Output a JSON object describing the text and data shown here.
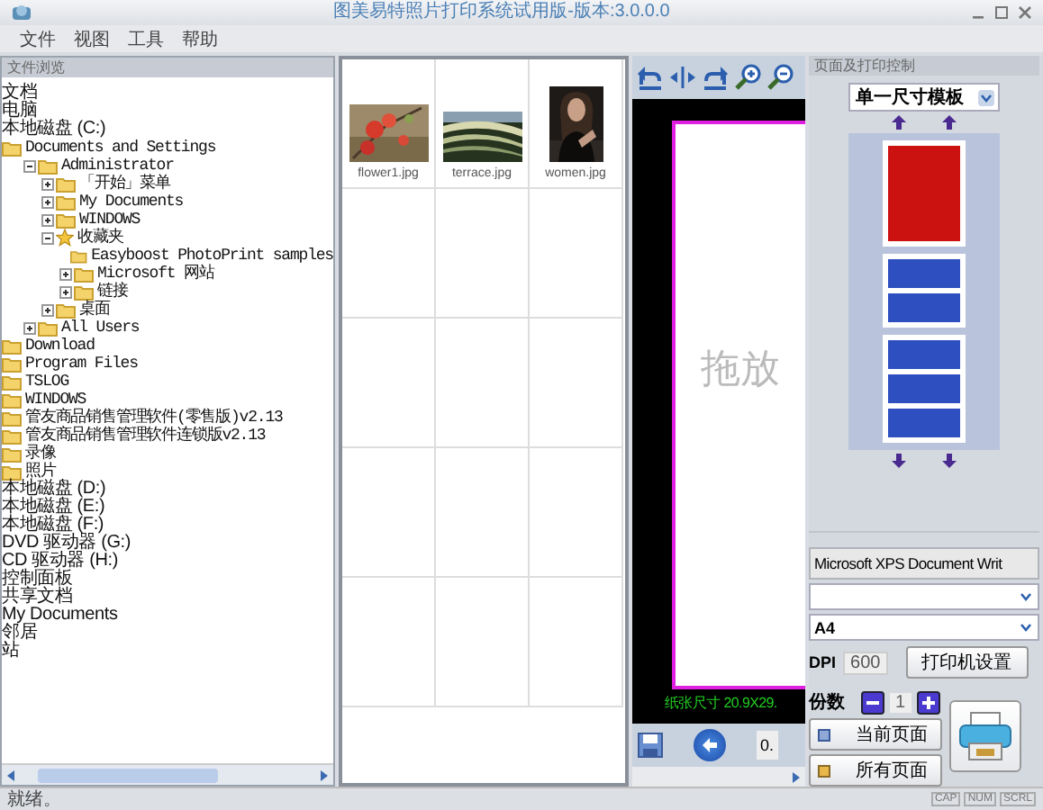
{
  "window": {
    "title": "图美易特照片打印系统试用版-版本:3.0.0.0"
  },
  "menu": [
    "文件",
    "视图",
    "工具",
    "帮助"
  ],
  "file_browser": {
    "title": "文件浏览",
    "tree": [
      {
        "label": "文档",
        "kind": "plain"
      },
      {
        "label": "电脑",
        "kind": "plain"
      },
      {
        "label": "本地磁盘 (C:)",
        "kind": "plain",
        "children": [
          {
            "label": "Documents and Settings",
            "kind": "folder",
            "children": [
              {
                "label": "Administrator",
                "kind": "folder",
                "expanded": true,
                "children": [
                  {
                    "label": "「开始」菜单",
                    "kind": "folder",
                    "expanded": false
                  },
                  {
                    "label": "My Documents",
                    "kind": "folder",
                    "expanded": false
                  },
                  {
                    "label": "WINDOWS",
                    "kind": "folder",
                    "expanded": false
                  },
                  {
                    "label": "收藏夹",
                    "kind": "favorites",
                    "expanded": true,
                    "children": [
                      {
                        "label": "Easyboost PhotoPrint samples",
                        "kind": "folder"
                      },
                      {
                        "label": "Microsoft 网站",
                        "kind": "folder",
                        "expanded": false
                      },
                      {
                        "label": "链接",
                        "kind": "folder",
                        "expanded": false
                      }
                    ]
                  },
                  {
                    "label": "桌面",
                    "kind": "folder",
                    "expanded": false
                  }
                ]
              },
              {
                "label": "All Users",
                "kind": "folder",
                "expanded": false
              }
            ]
          },
          {
            "label": "Download",
            "kind": "folder"
          },
          {
            "label": "Program Files",
            "kind": "folder"
          },
          {
            "label": "TSLOG",
            "kind": "folder"
          },
          {
            "label": "WINDOWS",
            "kind": "folder"
          },
          {
            "label": "管友商品销售管理软件(零售版)v2.13",
            "kind": "folder"
          },
          {
            "label": "管友商品销售管理软件连锁版v2.13",
            "kind": "folder"
          },
          {
            "label": "录像",
            "kind": "folder"
          },
          {
            "label": "照片",
            "kind": "folder"
          }
        ]
      },
      {
        "label": "本地磁盘 (D:)",
        "kind": "plain"
      },
      {
        "label": "本地磁盘 (E:)",
        "kind": "plain"
      },
      {
        "label": "本地磁盘 (F:)",
        "kind": "plain"
      },
      {
        "label": "DVD 驱动器 (G:)",
        "kind": "plain"
      },
      {
        "label": "CD 驱动器 (H:)",
        "kind": "plain"
      },
      {
        "label": "控制面板",
        "kind": "plain"
      },
      {
        "label": "共享文档",
        "kind": "plain"
      },
      {
        "label": "My Documents",
        "kind": "plain"
      },
      {
        "label": "邻居",
        "kind": "plain"
      },
      {
        "label": "站",
        "kind": "plain"
      }
    ]
  },
  "thumbnails": [
    {
      "name": "flower1.jpg"
    },
    {
      "name": "terrace.jpg"
    },
    {
      "name": "women.jpg"
    }
  ],
  "preview": {
    "placeholder_text": "拖放",
    "paper_label": "纸张尺寸 20.9X29.",
    "zoom_value": "0."
  },
  "control_panel": {
    "title": "页面及打印控制",
    "template": "单一尺寸模板",
    "layout_groups": [
      [
        {
          "selected": true
        }
      ],
      [
        {
          "selected": false
        },
        {
          "selected": false
        }
      ],
      [
        {
          "selected": false
        },
        {
          "selected": false
        },
        {
          "selected": false
        }
      ]
    ],
    "printer": "Microsoft XPS Document Writ",
    "paper_size": "A4",
    "dpi_label": "DPI",
    "dpi": "600",
    "printer_settings_button": "打印机设置",
    "copies_label": "份数",
    "copies": "1",
    "current_page_button": "当前页面",
    "all_pages_button": "所有页面"
  },
  "status_bar": {
    "text": "就绪。",
    "indicators": [
      "CAP",
      "NUM",
      "SCRL"
    ]
  }
}
